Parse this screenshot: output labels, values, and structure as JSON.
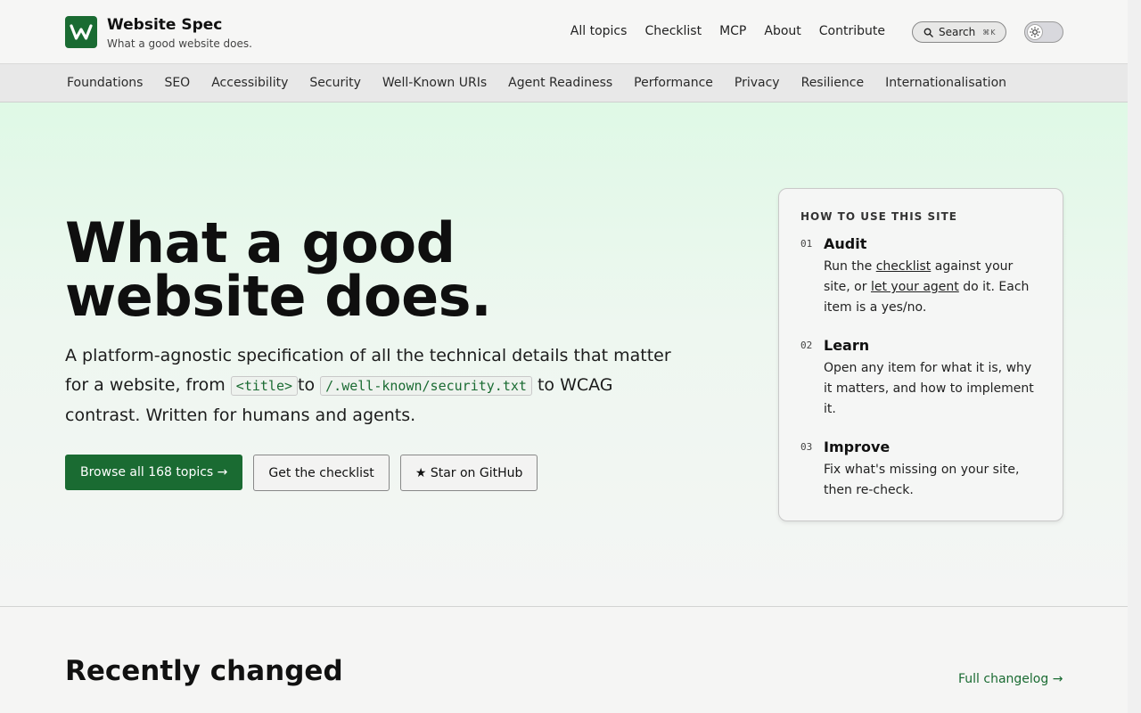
{
  "brand": {
    "name": "Website Spec",
    "tagline": "What a good website does."
  },
  "topnav": {
    "items": [
      "All topics",
      "Checklist",
      "MCP",
      "About",
      "Contribute"
    ],
    "search_label": "Search",
    "search_shortcut": "⌘K"
  },
  "categories": [
    "Foundations",
    "SEO",
    "Accessibility",
    "Security",
    "Well-Known URIs",
    "Agent Readiness",
    "Performance",
    "Privacy",
    "Resilience",
    "Internationalisation"
  ],
  "hero": {
    "title_line1": "What a good",
    "title_line2": "website does.",
    "sub_part1": "A platform-agnostic specification of all the technical details that matter for a website, from ",
    "code1": "<title>",
    "sub_part2": "to ",
    "code2": "/.well-known/security.txt",
    "sub_part3": " to WCAG contrast. Written for humans and agents.",
    "cta_primary": "Browse all 168 topics →",
    "cta_checklist": "Get the checklist",
    "cta_github": "★ Star on GitHub"
  },
  "howto": {
    "heading": "HOW TO USE THIS SITE",
    "steps": [
      {
        "num": "01",
        "title": "Audit",
        "text_before": "Run the ",
        "link1": "checklist",
        "text_mid": " against your site, or ",
        "link2": "let your agent",
        "text_after": " do it. Each item is a yes/no."
      },
      {
        "num": "02",
        "title": "Learn",
        "text": "Open any item for what it is, why it matters, and how to implement it."
      },
      {
        "num": "03",
        "title": "Improve",
        "text": "Fix what's missing on your site, then re-check."
      }
    ]
  },
  "recent": {
    "title": "Recently changed",
    "changelog_link": "Full changelog →"
  },
  "colors": {
    "brand_green": "#1a6b32"
  }
}
